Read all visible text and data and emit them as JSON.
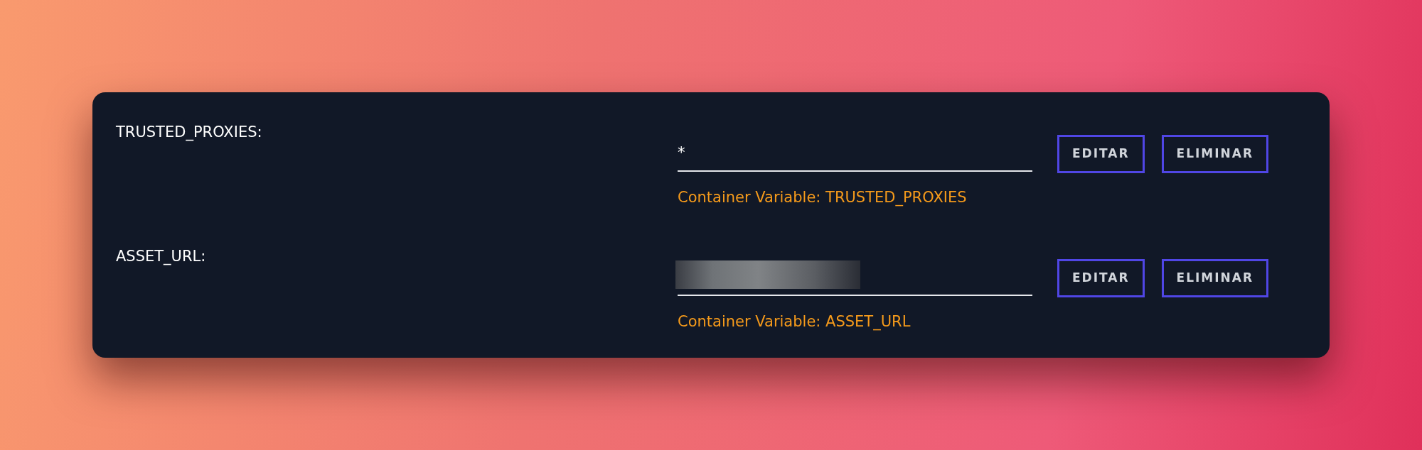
{
  "variables": [
    {
      "label": "TRUSTED_PROXIES:",
      "kind": "text",
      "value": "*",
      "helper": "Container Variable: TRUSTED_PROXIES",
      "buttons": [
        "EDITAR",
        "ELIMINAR"
      ]
    },
    {
      "label": "ASSET_URL:",
      "kind": "redacted",
      "helper": "Container Variable: ASSET_URL",
      "buttons": [
        "EDITAR",
        "ELIMINAR"
      ]
    }
  ]
}
